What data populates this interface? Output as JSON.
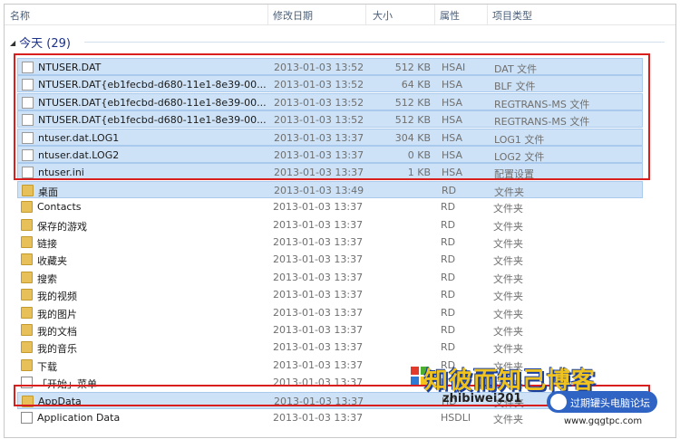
{
  "columns": {
    "name": "名称",
    "date": "修改日期",
    "size": "大小",
    "attr": "属性",
    "type": "项目类型"
  },
  "group": {
    "label": "今天 (29)"
  },
  "rows": [
    {
      "name": "NTUSER.DAT",
      "date": "2013-01-03 13:52",
      "size": "512 KB",
      "attr": "HSAI",
      "type": "DAT 文件",
      "icon": "file-icon"
    },
    {
      "name": "NTUSER.DAT{eb1fecbd-d680-11e1-8e39-00...",
      "date": "2013-01-03 13:52",
      "size": "64 KB",
      "attr": "HSA",
      "type": "BLF 文件",
      "icon": "file-icon"
    },
    {
      "name": "NTUSER.DAT{eb1fecbd-d680-11e1-8e39-00...",
      "date": "2013-01-03 13:52",
      "size": "512 KB",
      "attr": "HSA",
      "type": "REGTRANS-MS 文件",
      "icon": "file-icon"
    },
    {
      "name": "NTUSER.DAT{eb1fecbd-d680-11e1-8e39-00...",
      "date": "2013-01-03 13:52",
      "size": "512 KB",
      "attr": "HSA",
      "type": "REGTRANS-MS 文件",
      "icon": "file-icon"
    },
    {
      "name": "ntuser.dat.LOG1",
      "date": "2013-01-03 13:37",
      "size": "304 KB",
      "attr": "HSA",
      "type": "LOG1 文件",
      "icon": "file-icon"
    },
    {
      "name": "ntuser.dat.LOG2",
      "date": "2013-01-03 13:37",
      "size": "0 KB",
      "attr": "HSA",
      "type": "LOG2 文件",
      "icon": "file-icon"
    },
    {
      "name": "ntuser.ini",
      "date": "2013-01-03 13:37",
      "size": "1 KB",
      "attr": "HSA",
      "type": "配置设置",
      "icon": "settings-file-icon"
    },
    {
      "name": "桌面",
      "date": "2013-01-03 13:49",
      "size": "",
      "attr": "RD",
      "type": "文件夹",
      "icon": "folder-icon"
    },
    {
      "name": "Contacts",
      "date": "2013-01-03 13:37",
      "size": "",
      "attr": "RD",
      "type": "文件夹",
      "icon": "folder-icon"
    },
    {
      "name": "保存的游戏",
      "date": "2013-01-03 13:37",
      "size": "",
      "attr": "RD",
      "type": "文件夹",
      "icon": "folder-icon"
    },
    {
      "name": "链接",
      "date": "2013-01-03 13:37",
      "size": "",
      "attr": "RD",
      "type": "文件夹",
      "icon": "folder-icon"
    },
    {
      "name": "收藏夹",
      "date": "2013-01-03 13:37",
      "size": "",
      "attr": "RD",
      "type": "文件夹",
      "icon": "folder-icon"
    },
    {
      "name": "搜索",
      "date": "2013-01-03 13:37",
      "size": "",
      "attr": "RD",
      "type": "文件夹",
      "icon": "folder-icon"
    },
    {
      "name": "我的视频",
      "date": "2013-01-03 13:37",
      "size": "",
      "attr": "RD",
      "type": "文件夹",
      "icon": "folder-icon"
    },
    {
      "name": "我的图片",
      "date": "2013-01-03 13:37",
      "size": "",
      "attr": "RD",
      "type": "文件夹",
      "icon": "folder-icon"
    },
    {
      "name": "我的文档",
      "date": "2013-01-03 13:37",
      "size": "",
      "attr": "RD",
      "type": "文件夹",
      "icon": "folder-icon"
    },
    {
      "name": "我的音乐",
      "date": "2013-01-03 13:37",
      "size": "",
      "attr": "RD",
      "type": "文件夹",
      "icon": "folder-icon"
    },
    {
      "name": "下载",
      "date": "2013-01-03 13:37",
      "size": "",
      "attr": "RD",
      "type": "文件夹",
      "icon": "folder-icon"
    },
    {
      "name": "「开始」菜单",
      "date": "2013-01-03 13:37",
      "size": "",
      "attr": "HSDLI",
      "type": "文件夹",
      "icon": "shortcut-icon"
    },
    {
      "name": "AppData",
      "date": "2013-01-03 13:37",
      "size": "",
      "attr": "HD",
      "type": "文件夹",
      "icon": "folder-icon"
    },
    {
      "name": "Application Data",
      "date": "2013-01-03 13:37",
      "size": "",
      "attr": "HSDLI",
      "type": "文件夹",
      "icon": "shortcut-icon"
    }
  ],
  "watermark": {
    "title": "知彼而知己博客",
    "blog_url": "zhibiwei201",
    "badge": "过期罐头电脑论坛",
    "site": "www.gqgtpc.com"
  }
}
